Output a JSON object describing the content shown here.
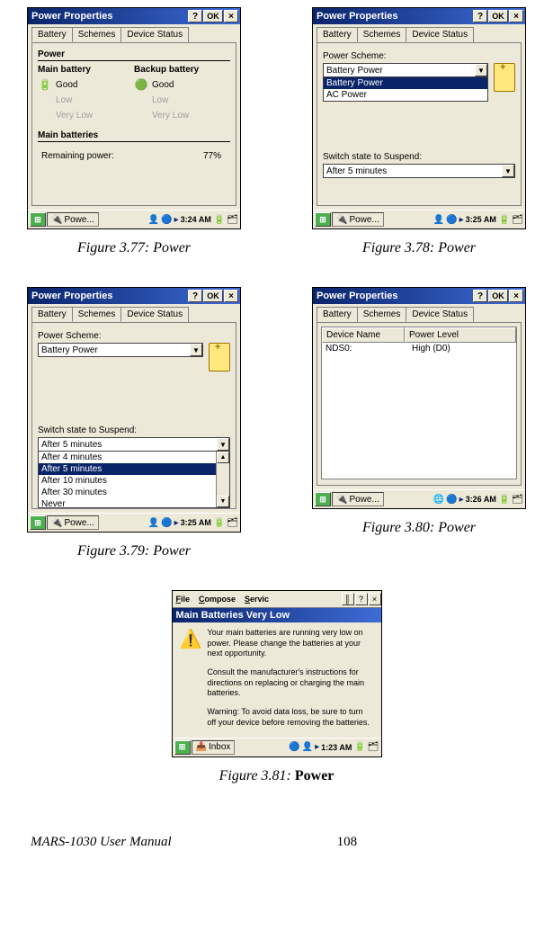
{
  "captions": {
    "fig77": "Figure 3.77: Power",
    "fig78": "Figure 3.78: Power",
    "fig79": "Figure 3.79: Power",
    "fig80": "Figure 3.80: Power",
    "fig81_prefix": "Figure 3.81: ",
    "fig81_bold": "Power"
  },
  "common": {
    "dialog_title": "Power Properties",
    "btn_help": "?",
    "btn_ok": "OK",
    "btn_close": "×",
    "tabs": {
      "battery": "Battery",
      "schemes": "Schemes",
      "device_status": "Device Status"
    }
  },
  "fig77": {
    "power_group": "Power",
    "main_batt_hdr": "Main battery",
    "backup_batt_hdr": "Backup battery",
    "good": "Good",
    "low": "Low",
    "very_low": "Very Low",
    "main_batts_group": "Main batteries",
    "remaining_label": "Remaining power:",
    "remaining_value": "77%",
    "taskbar": {
      "task": "Powe...",
      "clock": "3:24 AM"
    }
  },
  "fig78": {
    "scheme_label": "Power Scheme:",
    "combo_value": "Battery Power",
    "list": [
      "Battery Power",
      "AC Power"
    ],
    "selected": 0,
    "switch_label": "Switch state to Suspend:",
    "switch_value": "After 5 minutes",
    "taskbar": {
      "task": "Powe...",
      "clock": "3:25 AM"
    }
  },
  "fig79": {
    "scheme_label": "Power Scheme:",
    "combo_value": "Battery Power",
    "switch_label": "Switch state to Suspend:",
    "switch_value": "After 5 minutes",
    "list": [
      "After 4 minutes",
      "After 5 minutes",
      "After 10 minutes",
      "After 30 minutes",
      "Never"
    ],
    "selected": 1,
    "taskbar": {
      "task": "Powe...",
      "clock": "3:25 AM"
    }
  },
  "fig80": {
    "col1": "Device Name",
    "col2": "Power Level",
    "row1_name": "NDS0:",
    "row1_level": "High   (D0)",
    "taskbar": {
      "task": "Powe...",
      "clock": "3:26 AM"
    }
  },
  "fig81": {
    "menus": {
      "file": "File",
      "compose": "Compose",
      "service": "Servic"
    },
    "btn_help": "?",
    "btn_close": "×",
    "msg_title": "Main Batteries Very Low",
    "p1": "Your main batteries are running very low on power. Please change the batteries at your next opportunity.",
    "p2": "Consult the manufacturer's instructions for directions on replacing or charging the main batteries.",
    "p3": "Warning: To avoid data loss, be sure to turn off your device before removing the batteries.",
    "taskbar": {
      "task": "Inbox",
      "clock": "1:23 AM"
    }
  },
  "footer": {
    "left": "MARS-1030 User Manual",
    "page": "108"
  }
}
